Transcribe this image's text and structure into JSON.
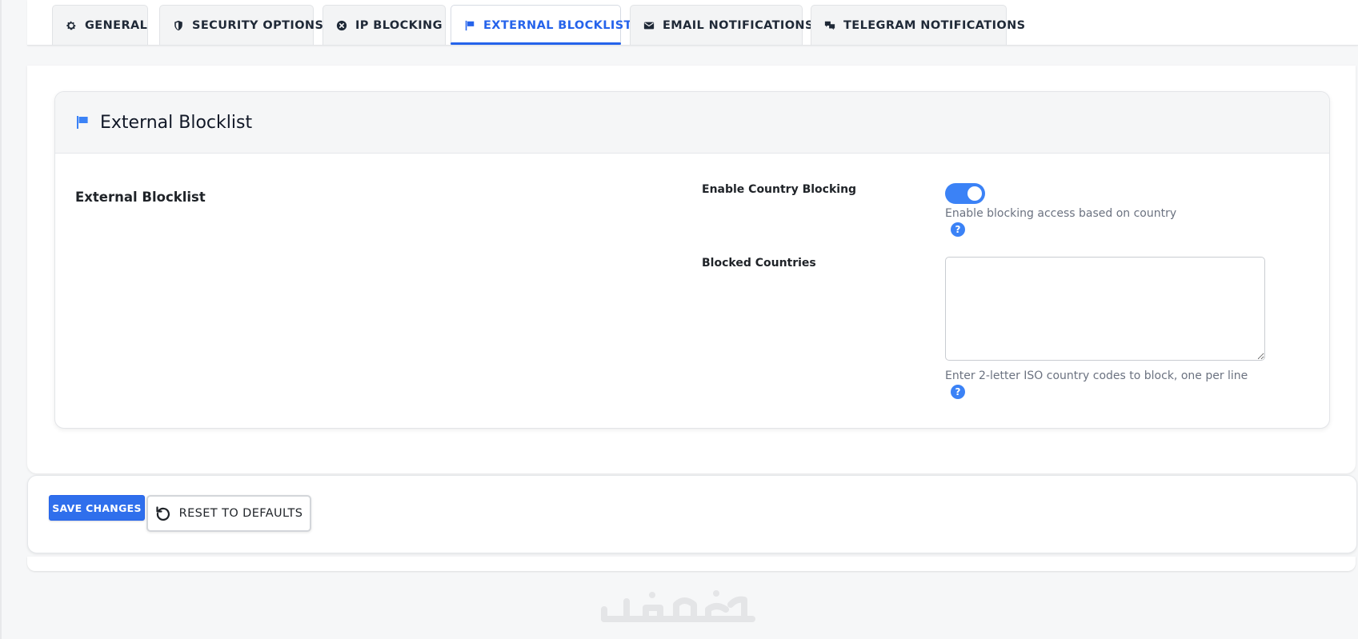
{
  "tabs": [
    {
      "label": "GENERAL",
      "icon": "gear-icon"
    },
    {
      "label": "SECURITY OPTIONS",
      "icon": "shield-icon"
    },
    {
      "label": "IP BLOCKING",
      "icon": "close-circle-icon"
    },
    {
      "label": "EXTERNAL BLOCKLIST",
      "icon": "flag-icon",
      "active": true
    },
    {
      "label": "EMAIL NOTIFICATIONS",
      "icon": "envelope-icon"
    },
    {
      "label": "TELEGRAM NOTIFICATIONS",
      "icon": "chat-icon"
    }
  ],
  "card": {
    "title": "External Blocklist",
    "icon": "flag-icon",
    "section_label": "External Blocklist",
    "enable_country_blocking": {
      "label": "Enable Country Blocking",
      "enabled": true,
      "help": "Enable blocking access based on country"
    },
    "blocked_countries": {
      "label": "Blocked Countries",
      "value": "",
      "help": "Enter 2-letter ISO country codes to block, one per line"
    }
  },
  "footer": {
    "save_label": "SAVE CHANGES",
    "reset_label": "RESET TO DEFAULTS",
    "reset_icon": "reset-icon"
  },
  "help_icon_glyph": "?",
  "colors": {
    "accent": "#2563eb",
    "toggle_on": "#3b82f6",
    "help_icon": "#3b82f6"
  }
}
